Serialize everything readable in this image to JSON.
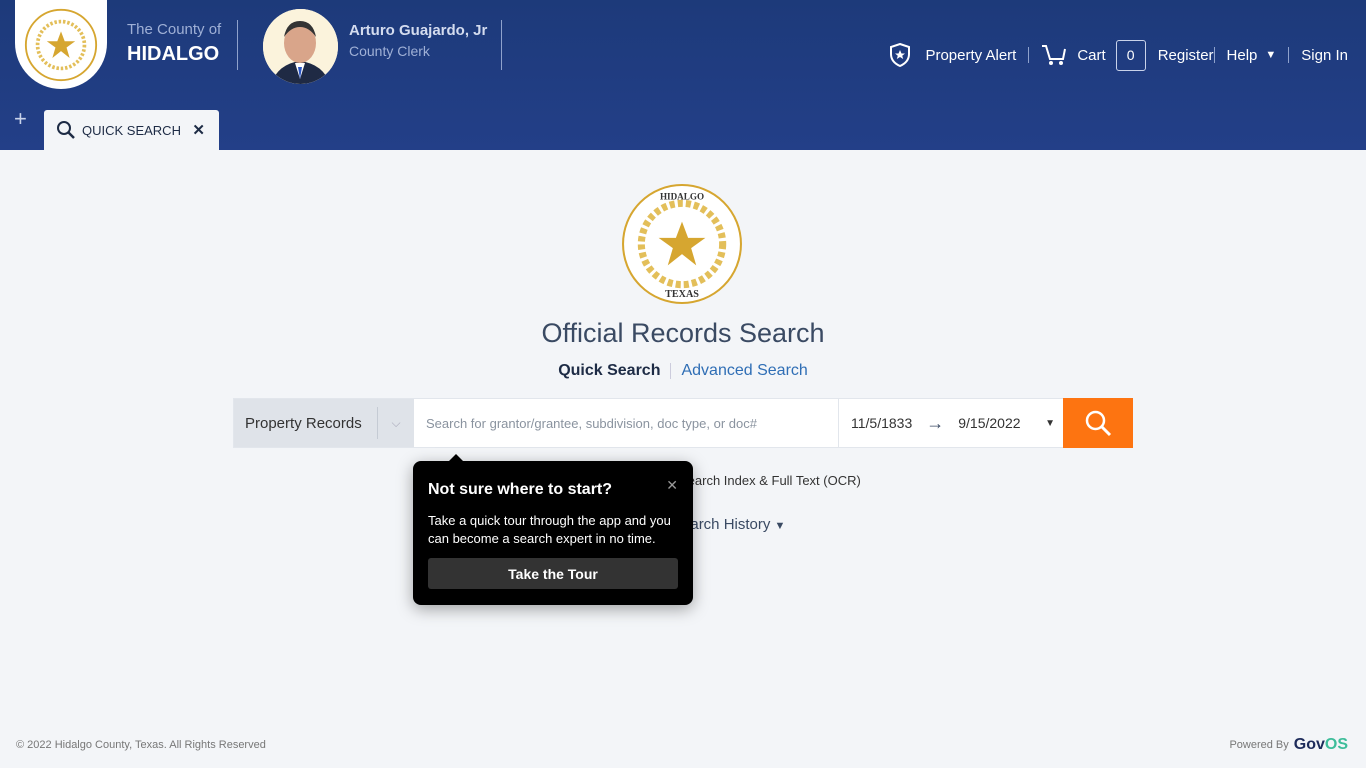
{
  "header": {
    "county_small": "The County of",
    "county_big": "HIDALGO",
    "seal_text_top": "THE COUNTY OF HIDALGO",
    "seal_text_bottom": "TEXAS",
    "clerk_name": "Arturo Guajardo, Jr",
    "clerk_title": "County Clerk"
  },
  "nav": {
    "property_alert": "Property Alert",
    "cart": "Cart",
    "cart_count": "0",
    "register": "Register",
    "help": "Help",
    "sign_in": "Sign In"
  },
  "tabs": [
    {
      "label": "QUICK SEARCH"
    }
  ],
  "main": {
    "title": "Official Records Search",
    "quick_search": "Quick Search",
    "advanced_search": "Advanced Search",
    "record_type": "Property Records",
    "search_placeholder": "Search for grantor/grantee, subdivision, doc type, or doc#",
    "date_from": "11/5/1833",
    "date_to": "9/15/2022",
    "ocr_label": "Search Index & Full Text (OCR)",
    "history_label": "Search History"
  },
  "popup": {
    "title": "Not sure where to start?",
    "body": "Take a quick tour through the app and you can become a search expert in no time.",
    "button": "Take the Tour"
  },
  "footer": {
    "copyright": "© 2022 Hidalgo County, Texas. All Rights Reserved",
    "powered_by": "Powered By",
    "brand_a": "Gov",
    "brand_b": "OS"
  },
  "colors": {
    "header": "#1d3a7a",
    "accent": "#fd7411",
    "link": "#2f6eb5"
  }
}
